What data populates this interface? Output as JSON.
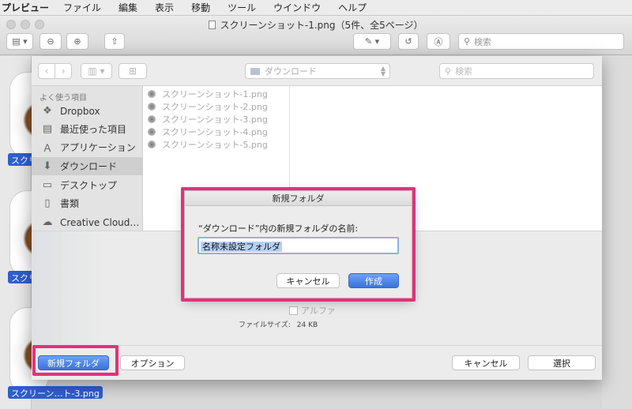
{
  "menubar": {
    "app": "プレビュー",
    "items": [
      "ファイル",
      "編集",
      "表示",
      "移動",
      "ツール",
      "ウインドウ",
      "ヘルプ"
    ]
  },
  "window": {
    "title": "スクリーンショット-1.png（5件、全5ページ）",
    "search_placeholder": "検索"
  },
  "thumbnails": {
    "labels": [
      "スクリ",
      "スクリ",
      "スクリーン…ト-3.png"
    ]
  },
  "sheet": {
    "location": "ダウンロード",
    "search_placeholder": "検索",
    "sidebar": {
      "heading": "よく使う項目",
      "items": [
        {
          "label": "Dropbox",
          "icon": "dropbox-icon"
        },
        {
          "label": "最近使った項目",
          "icon": "recents-icon"
        },
        {
          "label": "アプリケーション",
          "icon": "applications-icon"
        },
        {
          "label": "ダウンロード",
          "icon": "downloads-icon"
        },
        {
          "label": "デスクトップ",
          "icon": "desktop-icon"
        },
        {
          "label": "書類",
          "icon": "documents-icon"
        },
        {
          "label": "Creative Cloud…",
          "icon": "creative-cloud-icon"
        }
      ]
    },
    "files": [
      "スクリーンショット-1.png",
      "スクリーンショット-2.png",
      "スクリーンショット-3.png",
      "スクリーンショット-4.png",
      "スクリーンショット-5.png"
    ],
    "options": {
      "alpha_label": "アルファ",
      "file_size_label": "ファイルサイズ:",
      "file_size_value": "24 KB"
    },
    "buttons": {
      "new_folder": "新規フォルダ",
      "options": "オプション",
      "cancel": "キャンセル",
      "select": "選択"
    }
  },
  "dialog": {
    "title": "新規フォルダ",
    "prompt": "“ダウンロード”内の新規フォルダの名前:",
    "input_value": "名称未設定フォルダ",
    "cancel": "キャンセル",
    "create": "作成"
  },
  "colors": {
    "highlight_border": "#e2327a",
    "accent_blue": "#3a72d9",
    "selection_label": "#2f5fd0"
  }
}
